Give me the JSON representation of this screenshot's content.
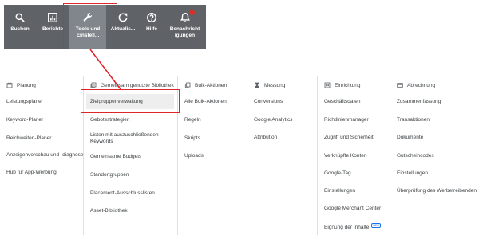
{
  "toolbar": {
    "buttons": [
      {
        "label": "Suchen",
        "icon": "search-icon"
      },
      {
        "label": "Berichte",
        "icon": "reports-icon"
      },
      {
        "label": "Tools und\nEinstell...",
        "icon": "wrench-icon",
        "active": true
      },
      {
        "label": "Aktualis...",
        "icon": "refresh-icon"
      },
      {
        "label": "Hilfe",
        "icon": "help-icon"
      },
      {
        "label": "Benachricht\nigungen",
        "icon": "bell-icon",
        "badge": "!"
      }
    ]
  },
  "menu": {
    "columns": [
      {
        "title": "Planung",
        "icon": "calendar-icon",
        "items": [
          "Leistungsplaner",
          "Keyword-Planer",
          "Reichweiten-Planer",
          "Anzeigenvorschau und -diagnose",
          "Hub für App-Werbung"
        ]
      },
      {
        "title": "Gemeinsam genutzte Bibliothek",
        "icon": "library-icon",
        "items": [
          "Zielgruppenverwaltung",
          "Gebotsstrategien",
          "Listen mit auszuschließenden Keywords",
          "Gemeinsame Budgets",
          "Standortgruppen",
          "Placement-Ausschlusslisten",
          "Asset-Bibliothek"
        ]
      },
      {
        "title": "Bulk-Aktionen",
        "icon": "copy-icon",
        "items": [
          "Alle Bulk-Aktionen",
          "Regeln",
          "Skripts",
          "Uploads"
        ]
      },
      {
        "title": "Messung",
        "icon": "hourglass-icon",
        "items": [
          "Conversions",
          "Google Analytics",
          "Attribution"
        ]
      },
      {
        "title": "Einrichtung",
        "icon": "setup-icon",
        "items": [
          "Geschäftsdaten",
          "Richtlinienmanager",
          "Zugriff und Sicherheit",
          "Verknüpfte Konten",
          "Google-Tag",
          "Einstellungen",
          "Google Merchant Center",
          "Eignung der Inhalte"
        ],
        "new_badge": "NEU"
      },
      {
        "title": "Abrechnung",
        "icon": "card-icon",
        "items": [
          "Zusammenfassung",
          "Transaktionen",
          "Dokumente",
          "Gutscheincodes",
          "Einstellungen",
          "Überprüfung des Werbetreibenden"
        ]
      }
    ]
  },
  "colors": {
    "toolbar_bg": "#5f6368",
    "toolbar_active_bg": "#80868b",
    "annotation_red": "#e0252b",
    "badge_red": "#d93025",
    "selected_item_bg": "#eeeeee"
  }
}
